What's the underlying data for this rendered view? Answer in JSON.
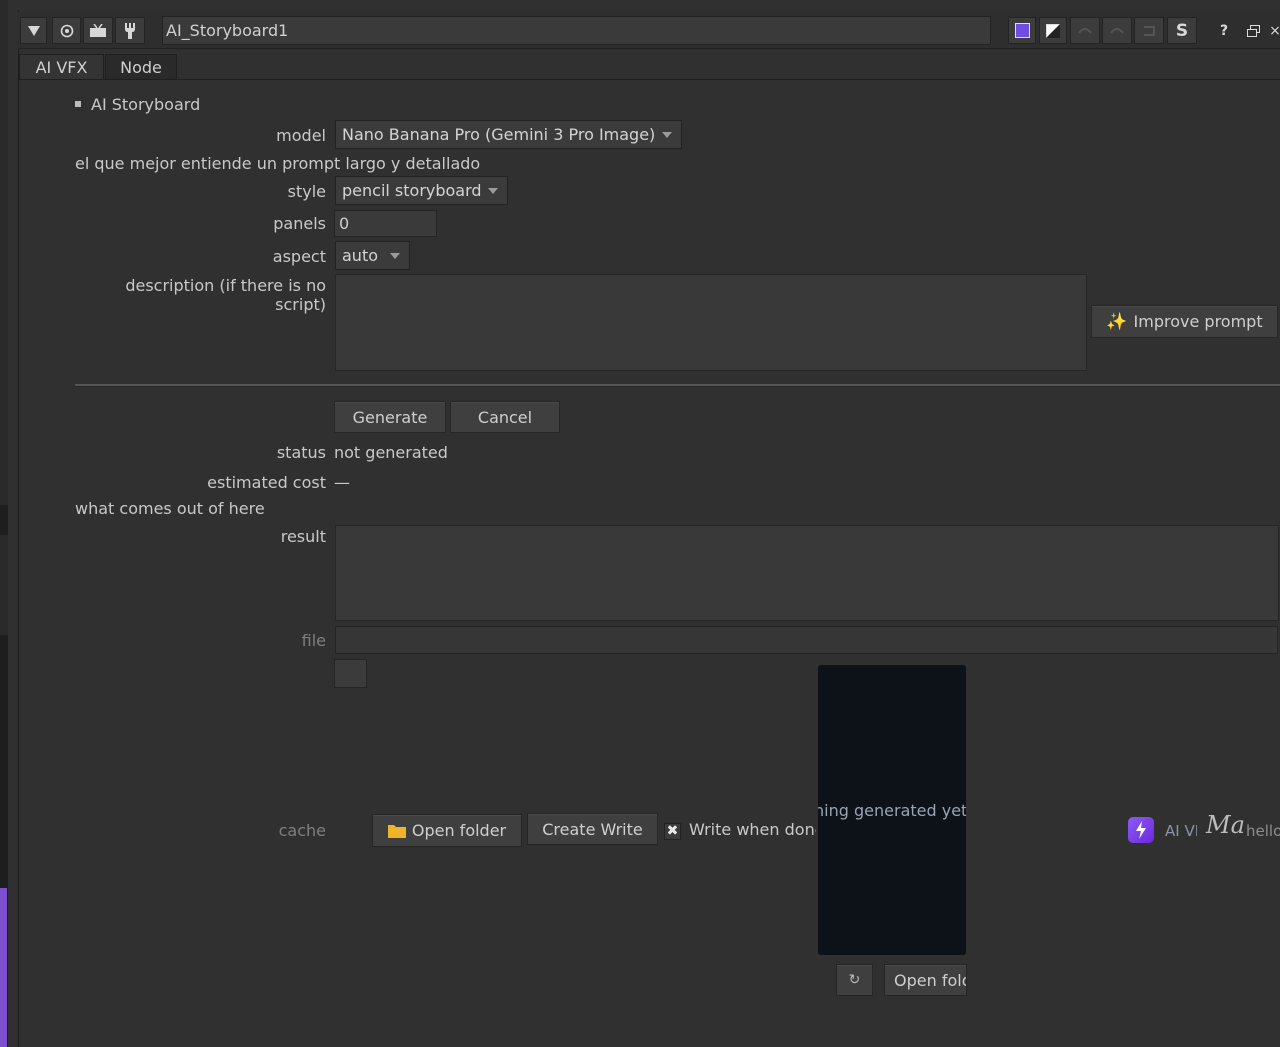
{
  "header": {
    "title": "AI_Storyboard1"
  },
  "tabs": [
    {
      "label": "AI VFX"
    },
    {
      "label": "Node"
    }
  ],
  "section": {
    "title": "AI Storyboard"
  },
  "form": {
    "model_label": "model",
    "model_value": "Nano Banana Pro (Gemini 3 Pro Image)",
    "model_hint": "el que mejor entiende un prompt largo y detallado",
    "style_label": "style",
    "style_value": "pencil storyboard",
    "panels_label": "panels",
    "panels_value": "0",
    "aspect_label": "aspect",
    "aspect_value": "auto",
    "description_label": "description (if there is no script)",
    "improve_prompt": "Improve prompt"
  },
  "actions": {
    "generate": "Generate",
    "cancel": "Cancel"
  },
  "status": {
    "status_label": "status",
    "status_value": "not generated",
    "cost_label": "estimated cost",
    "cost_value": "—",
    "output_heading": "what comes out of here",
    "result_label": "result",
    "file_label": "file"
  },
  "cache": {
    "label": "cache",
    "open_folder": "Open folder",
    "create_write": "Create Write",
    "write_when_done": "Write when done"
  },
  "preview": {
    "empty_text": "Nothing generated yet",
    "open_folder": "Open folder"
  },
  "footer": {
    "ai_label": "AI VFX",
    "signature": "Ma",
    "greeting": "hello"
  },
  "colors": {
    "accent": "#7e60c8",
    "background": "#303030",
    "preview_bg": "#0d1118"
  }
}
